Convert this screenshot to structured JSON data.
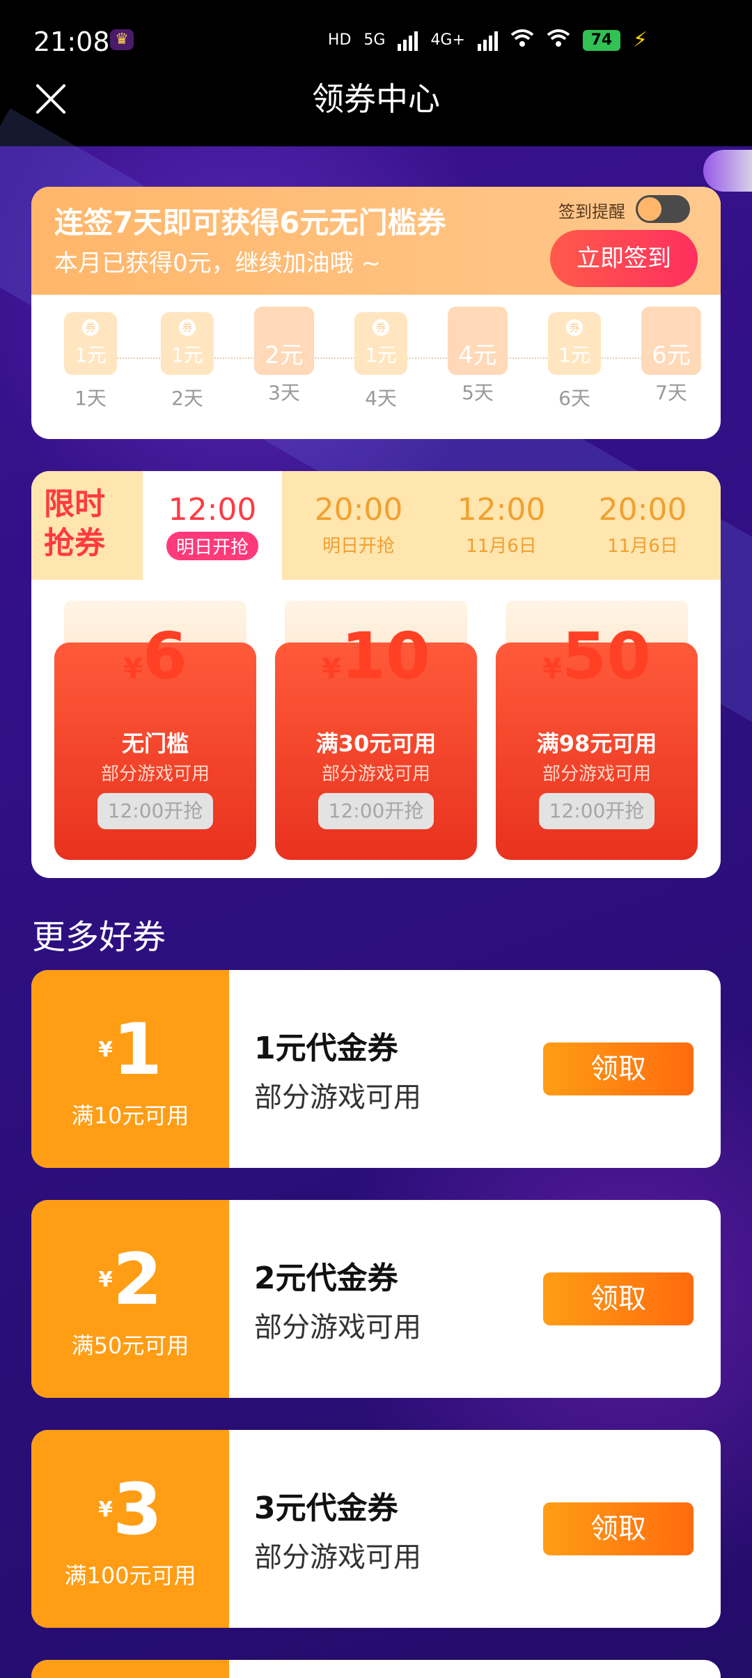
{
  "status": {
    "time": "21:08",
    "battery": "74",
    "hd": "HD",
    "net1": "5G",
    "net2": "4G+"
  },
  "header": {
    "title": "领券中心"
  },
  "signin": {
    "title": "连签7天即可获得6元无门槛券",
    "subtitle": "本月已获得0元，继续加油哦 ~",
    "remind_label": "签到提醒",
    "button": "立即签到",
    "coupon_tag": "券",
    "days": [
      {
        "label": "1天",
        "amount": "1元"
      },
      {
        "label": "2天",
        "amount": "1元"
      },
      {
        "label": "3天",
        "amount": "2元"
      },
      {
        "label": "4天",
        "amount": "1元"
      },
      {
        "label": "5天",
        "amount": "4元"
      },
      {
        "label": "6天",
        "amount": "1元"
      },
      {
        "label": "7天",
        "amount": "6元"
      }
    ]
  },
  "limited": {
    "label_line1": "限时",
    "label_line2": "抢券",
    "tabs": [
      {
        "time": "12:00",
        "note": "明日开抢"
      },
      {
        "time": "20:00",
        "note": "明日开抢"
      },
      {
        "time": "12:00",
        "note": "11月6日"
      },
      {
        "time": "20:00",
        "note": "11月6日"
      }
    ],
    "currency": "¥",
    "coupons": [
      {
        "value": "6",
        "condition": "无门槛",
        "scope": "部分游戏可用",
        "button": "12:00开抢"
      },
      {
        "value": "10",
        "condition": "满30元可用",
        "scope": "部分游戏可用",
        "button": "12:00开抢"
      },
      {
        "value": "50",
        "condition": "满98元可用",
        "scope": "部分游戏可用",
        "button": "12:00开抢"
      }
    ]
  },
  "more": {
    "title": "更多好券",
    "currency": "¥",
    "items": [
      {
        "amount": "1",
        "min": "满10元可用",
        "title": "1元代金券",
        "scope": "部分游戏可用",
        "button": "领取"
      },
      {
        "amount": "2",
        "min": "满50元可用",
        "title": "2元代金券",
        "scope": "部分游戏可用",
        "button": "领取"
      },
      {
        "amount": "3",
        "min": "满100元可用",
        "title": "3元代金券",
        "scope": "部分游戏可用",
        "button": "领取"
      }
    ]
  }
}
